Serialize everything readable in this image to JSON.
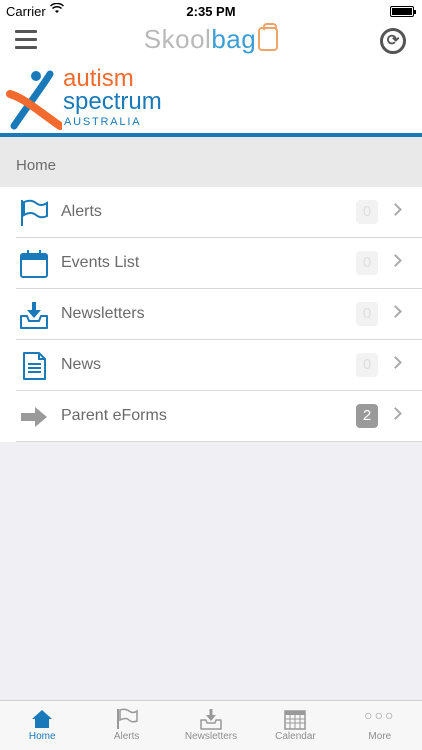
{
  "status_bar": {
    "carrier": "Carrier",
    "time": "2:35 PM"
  },
  "nav": {
    "title_part1": "Skool",
    "title_part2": "bag",
    "menu_icon": "hamburger-icon",
    "sync_icon": "sync-icon"
  },
  "banner": {
    "line1": "autism",
    "line2": "spectrum",
    "line3": "AUSTRALIA",
    "colors": {
      "orange": "#f26a2e",
      "blue": "#1a7ab9"
    }
  },
  "section": {
    "title": "Home"
  },
  "items": [
    {
      "label": "Alerts",
      "count": "0",
      "icon": "flag-icon"
    },
    {
      "label": "Events List",
      "count": "0",
      "icon": "calendar-icon"
    },
    {
      "label": "Newsletters",
      "count": "0",
      "icon": "inbox-download-icon"
    },
    {
      "label": "News",
      "count": "0",
      "icon": "document-icon"
    },
    {
      "label": "Parent eForms",
      "count": "2",
      "icon": "arrow-right-icon"
    }
  ],
  "tabs": [
    {
      "label": "Home",
      "icon": "home-icon",
      "active": true
    },
    {
      "label": "Alerts",
      "icon": "flag-icon"
    },
    {
      "label": "Newsletters",
      "icon": "inbox-download-icon"
    },
    {
      "label": "Calendar",
      "icon": "calendar-grid-icon"
    },
    {
      "label": "More",
      "icon": "more-dots-icon"
    }
  ],
  "accent": "#1a7ab9"
}
